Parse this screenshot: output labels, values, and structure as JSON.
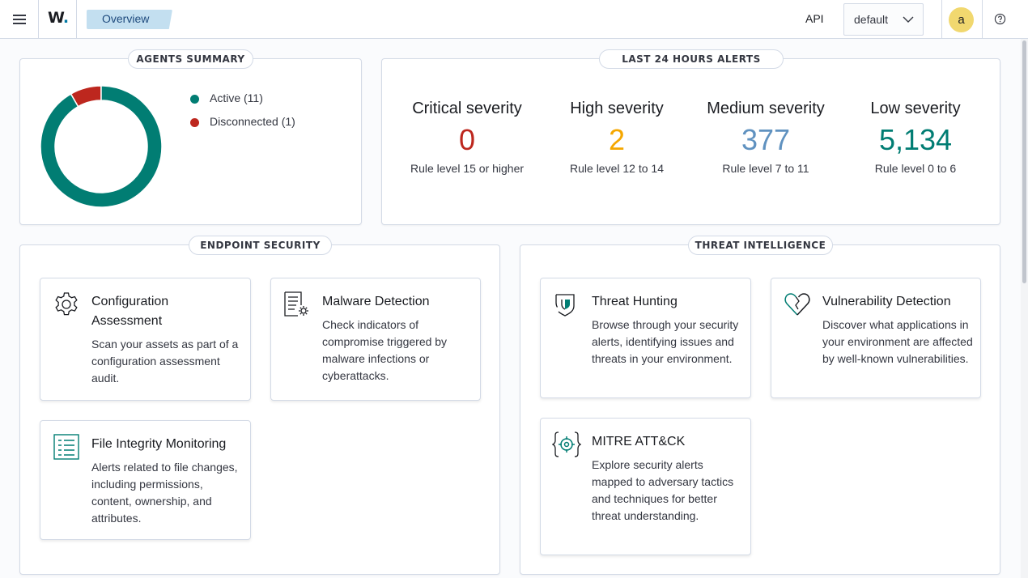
{
  "header": {
    "logo_text": "W",
    "logo_dot": ".",
    "breadcrumb": "Overview",
    "api_label": "API",
    "api_value": "default",
    "avatar_letter": "a",
    "icons": [
      "menu-icon",
      "chevron-down-icon",
      "help-icon"
    ]
  },
  "agents_summary": {
    "title": "AGENTS SUMMARY",
    "legend": [
      {
        "label": "Active (11)",
        "value": 11,
        "color": "#017d73"
      },
      {
        "label": "Disconnected (1)",
        "value": 1,
        "color": "#bd271e"
      }
    ]
  },
  "alerts": {
    "title": "LAST 24 HOURS ALERTS",
    "items": [
      {
        "title": "Critical severity",
        "value": "0",
        "desc": "Rule level 15 or higher",
        "color": "#bd271e"
      },
      {
        "title": "High severity",
        "value": "2",
        "desc": "Rule level 12 to 14",
        "color": "#f5a700"
      },
      {
        "title": "Medium severity",
        "value": "377",
        "desc": "Rule level 7 to 11",
        "color": "#6092c0"
      },
      {
        "title": "Low severity",
        "value": "5,134",
        "desc": "Rule level 0 to 6",
        "color": "#017d73"
      }
    ]
  },
  "endpoint_security": {
    "title": "ENDPOINT SECURITY",
    "cards": [
      {
        "title": "Configuration Assessment",
        "desc": "Scan your assets as part of a configuration assessment audit.",
        "icon": "gear-icon"
      },
      {
        "title": "Malware Detection",
        "desc": "Check indicators of compromise triggered by malware infections or cyberattacks.",
        "icon": "document-gear-icon"
      },
      {
        "title": "File Integrity Monitoring",
        "desc": "Alerts related to file changes, including permissions, content, ownership, and attributes.",
        "icon": "list-icon"
      }
    ]
  },
  "threat_intelligence": {
    "title": "THREAT INTELLIGENCE",
    "cards": [
      {
        "title": "Threat Hunting",
        "desc": "Browse through your security alerts, identifying issues and threats in your environment.",
        "icon": "shield-icon"
      },
      {
        "title": "Vulnerability Detection",
        "desc": "Discover what applications in your environment are affected by well-known vulnerabilities.",
        "icon": "broken-heart-icon"
      },
      {
        "title": "MITRE ATT&CK",
        "desc": "Explore security alerts mapped to adversary tactics and techniques for better threat understanding.",
        "icon": "crosshair-icon"
      }
    ]
  },
  "colors": {
    "accent": "#017d73",
    "danger": "#bd271e",
    "warning": "#f5a700",
    "info": "#6092c0"
  }
}
